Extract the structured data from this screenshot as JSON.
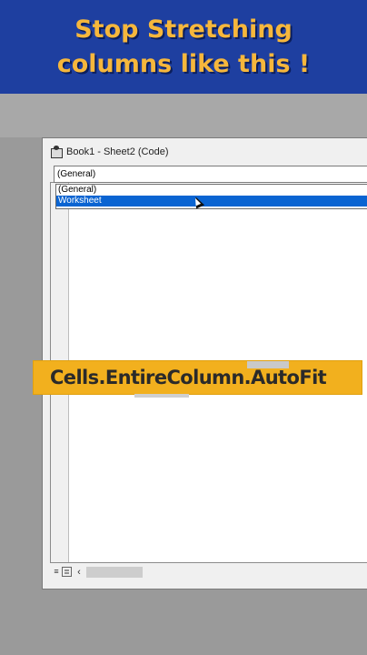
{
  "banner": {
    "line1": "Stop  Stretching",
    "line2": "columns like this !"
  },
  "window": {
    "title": "Book1 - Sheet2 (Code)",
    "object_combo_value": "(General)",
    "dropdown_options": [
      "(General)",
      "Worksheet"
    ],
    "selected_option": "Worksheet"
  },
  "overlay": {
    "code_text": "Cells.EntireColumn.AutoFit"
  },
  "colors": {
    "banner_bg": "#1e3fa0",
    "banner_text": "#f6b73c",
    "highlight_bar": "#f2b01e",
    "selection": "#0a64d2"
  },
  "icons": {
    "window_icon": "vba-module-icon",
    "procedure_view": "procedure-view-icon",
    "full_module_view": "full-module-view-icon",
    "scroll_left": "scroll-left-icon",
    "mouse_pointer": "mouse-pointer-icon"
  }
}
